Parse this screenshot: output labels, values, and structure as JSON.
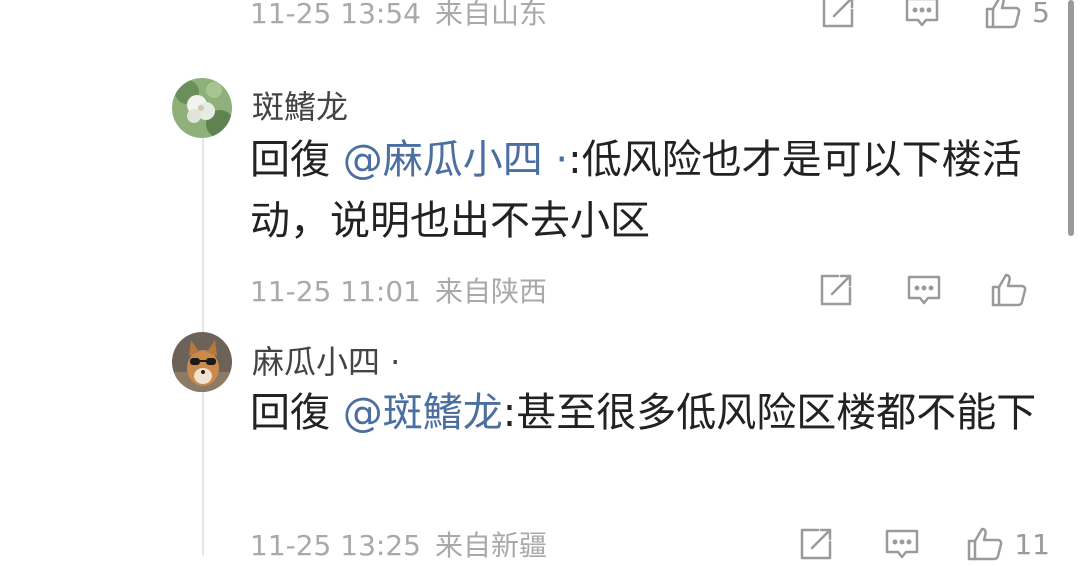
{
  "comments": [
    {
      "time": "11-25 13:54",
      "source": "来自山东",
      "likes": "5"
    },
    {
      "author": "斑鰭龙",
      "reply_prefix": "回復",
      "mention": "@麻瓜小四 ·",
      "body": ":低风险也才是可以下楼活动，说明也出不去小区",
      "time": "11-25 11:01",
      "source": "来自陕西",
      "likes": ""
    },
    {
      "author": "麻瓜小四 ·",
      "reply_prefix": "回復",
      "mention": "@斑鰭龙",
      "body": ":甚至很多低风险区楼都不能下",
      "time": "11-25 13:25",
      "source": "来自新疆",
      "likes": "11"
    }
  ],
  "icons": {
    "share": "share-icon",
    "comment": "comment-icon",
    "like": "like-icon"
  },
  "colors": {
    "mention": "#4a6fa0",
    "meta": "#a9a9a9",
    "text": "#222222"
  }
}
